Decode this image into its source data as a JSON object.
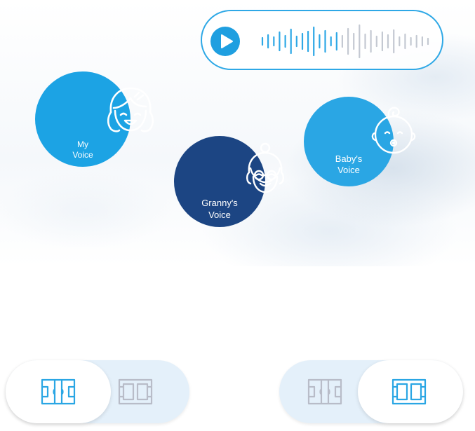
{
  "player": {
    "play_icon": "play-icon",
    "waveform_icon": "audio-waveform-icon",
    "accent_color": "#2ea8e6",
    "progress": 0.45
  },
  "voices": [
    {
      "id": "my",
      "line1": "My",
      "line2": "Voice",
      "icon": "girl-face-icon",
      "color": "#1ca3e4"
    },
    {
      "id": "granny",
      "line1": "Granny's",
      "line2": "Voice",
      "icon": "grandmother-face-icon",
      "color": "#1c4583"
    },
    {
      "id": "baby",
      "line1": "Baby's",
      "line2": "Voice",
      "icon": "baby-face-icon",
      "color": "#2aa6e4"
    }
  ],
  "toggles": [
    {
      "id": "left",
      "selected": "first",
      "icons": [
        "layout-a-icon",
        "layout-b-icon"
      ]
    },
    {
      "id": "right",
      "selected": "second",
      "icons": [
        "layout-a-icon",
        "layout-b-icon"
      ]
    }
  ],
  "colors": {
    "active_icon": "#2aa6e4",
    "inactive_icon": "#b8bcc8",
    "track": "#e4f0fa"
  }
}
